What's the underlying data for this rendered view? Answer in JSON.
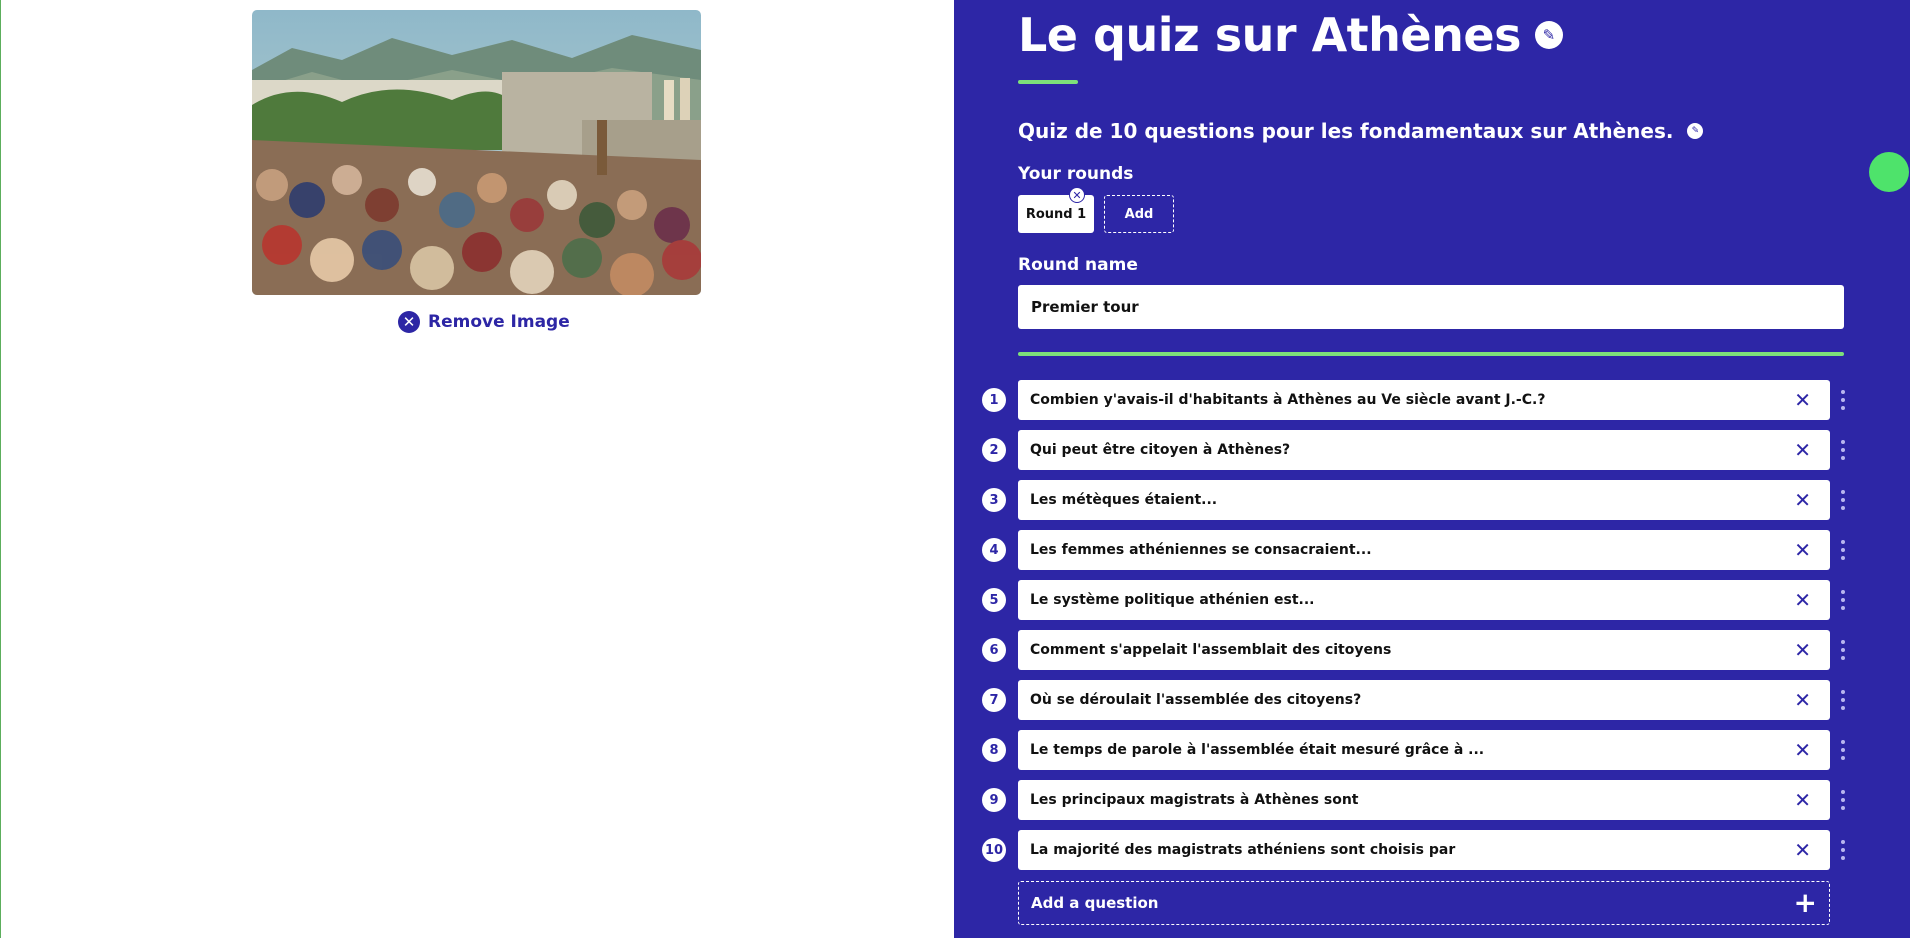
{
  "image_panel": {
    "remove_label": "Remove Image"
  },
  "quiz": {
    "title": "Le quiz sur Athènes",
    "description": "Quiz de 10 questions pour les fondamentaux sur Athènes."
  },
  "rounds": {
    "label": "Your rounds",
    "items": [
      {
        "label": "Round 1"
      }
    ],
    "add_label": "Add"
  },
  "round_name": {
    "label": "Round name",
    "value": "Premier tour"
  },
  "questions": [
    {
      "number": "1",
      "text": "Combien y'avais-il d'habitants à Athènes au Ve siècle avant J.-C.?"
    },
    {
      "number": "2",
      "text": "Qui peut être citoyen à Athènes?"
    },
    {
      "number": "3",
      "text": "Les métèques étaient..."
    },
    {
      "number": "4",
      "text": "Les femmes athéniennes se consacraient..."
    },
    {
      "number": "5",
      "text": "Le système politique athénien est..."
    },
    {
      "number": "6",
      "text": "Comment s'appelait l'assemblait des citoyens"
    },
    {
      "number": "7",
      "text": "Où se déroulait l'assemblée des citoyens?"
    },
    {
      "number": "8",
      "text": "Le temps de parole à l'assemblée était mesuré grâce à ..."
    },
    {
      "number": "9",
      "text": "Les principaux magistrats à Athènes sont"
    },
    {
      "number": "10",
      "text": "La majorité des magistrats athéniens sont choisis par"
    }
  ],
  "add_question_label": "Add a question",
  "icons": {
    "edit": "pencil-icon",
    "remove": "close-circle-icon",
    "delete": "x-icon",
    "drag": "vertical-dots-icon",
    "add": "plus-icon"
  },
  "colors": {
    "panel": "#2d26a6",
    "accent": "#7de07a",
    "status_dot": "#4ee36b"
  }
}
